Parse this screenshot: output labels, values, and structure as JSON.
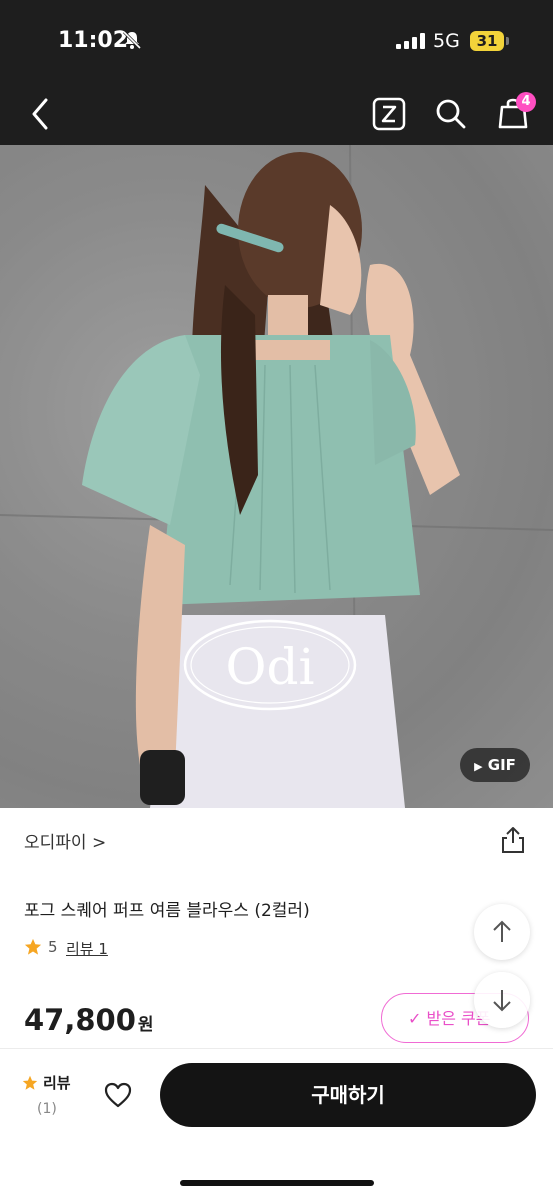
{
  "status": {
    "time": "11:02",
    "network": "5G",
    "battery": "31"
  },
  "nav": {
    "cart_count": "4"
  },
  "hero": {
    "logo_text": "Odi",
    "gif_label": "GIF"
  },
  "product": {
    "brand": "오디파이 >",
    "title": "포그 스퀘어 퍼프 여름 블라우스 (2컬러)",
    "rating": "5",
    "review_link": "리뷰 1",
    "price": "47,800",
    "price_unit": "원",
    "coupon_label": "✓ 받은 쿠폰"
  },
  "bottom": {
    "review_label": "리뷰",
    "review_count": "(1)",
    "buy_label": "구매하기"
  },
  "colors": {
    "accent": "#ff4fc2",
    "star": "#f6a623",
    "blouse": "#8fbfb0",
    "dark": "#141414"
  }
}
